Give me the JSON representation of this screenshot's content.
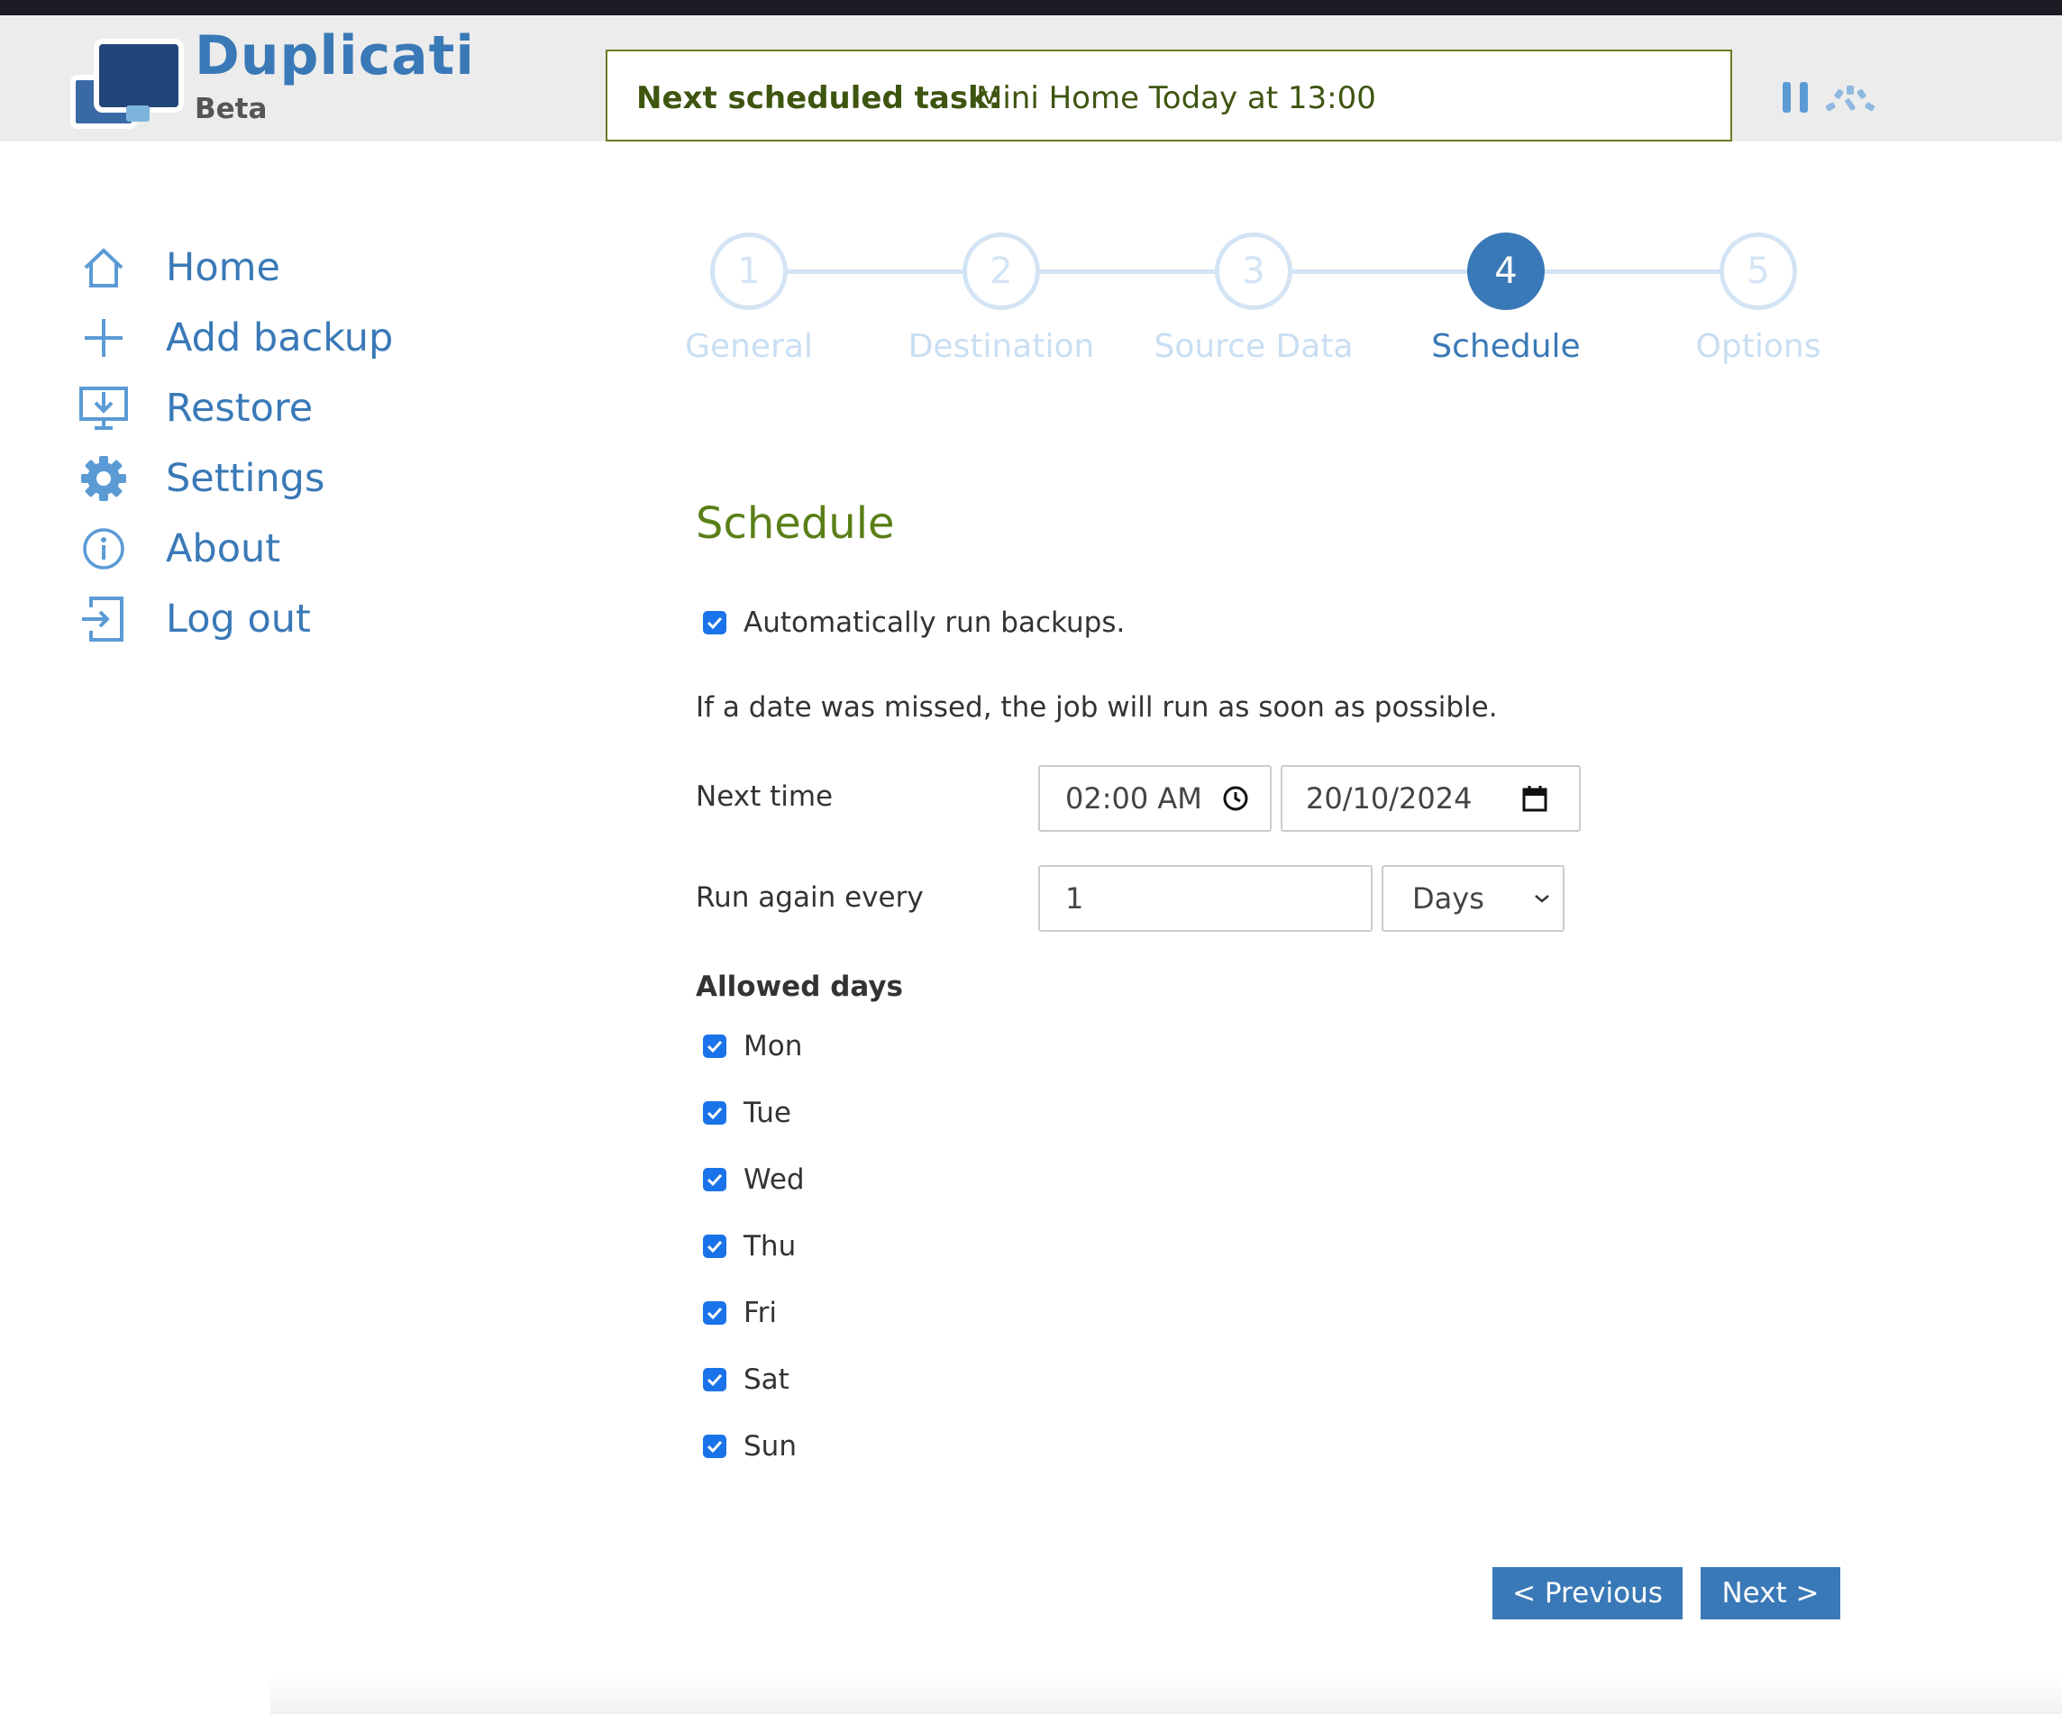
{
  "app": {
    "name": "Duplicati",
    "edition": "Beta"
  },
  "status": {
    "label": "Next scheduled task:",
    "value": "Mini Home Today at 13:00"
  },
  "toolbar_icons": [
    "pause-icon",
    "throttle-icon"
  ],
  "sidebar": {
    "items": [
      {
        "label": "Home",
        "icon": "home-icon"
      },
      {
        "label": "Add backup",
        "icon": "plus-icon"
      },
      {
        "label": "Restore",
        "icon": "restore-icon"
      },
      {
        "label": "Settings",
        "icon": "gear-icon"
      },
      {
        "label": "About",
        "icon": "info-icon"
      },
      {
        "label": "Log out",
        "icon": "logout-icon"
      }
    ]
  },
  "wizard": {
    "active_step": 4,
    "steps": [
      {
        "number": "1",
        "label": "General"
      },
      {
        "number": "2",
        "label": "Destination"
      },
      {
        "number": "3",
        "label": "Source Data"
      },
      {
        "number": "4",
        "label": "Schedule"
      },
      {
        "number": "5",
        "label": "Options"
      }
    ]
  },
  "schedule": {
    "title": "Schedule",
    "auto_run_label": "Automatically run backups.",
    "auto_run_checked": true,
    "missed_note": "If a date was missed, the job will run as soon as possible.",
    "next_time_label": "Next time",
    "next_time_value": "02:00 AM",
    "next_date_value": "20/10/2024",
    "run_again_label": "Run again every",
    "run_again_value": "1",
    "run_again_unit": "Days",
    "allowed_days_label": "Allowed days",
    "days": [
      {
        "label": "Mon",
        "checked": true
      },
      {
        "label": "Tue",
        "checked": true
      },
      {
        "label": "Wed",
        "checked": true
      },
      {
        "label": "Thu",
        "checked": true
      },
      {
        "label": "Fri",
        "checked": true
      },
      {
        "label": "Sat",
        "checked": true
      },
      {
        "label": "Sun",
        "checked": true
      }
    ]
  },
  "nav_buttons": {
    "previous": "< Previous",
    "next": "Next >"
  },
  "colors": {
    "accent": "#3a79b7",
    "status_text": "#3e5510",
    "section_title": "#5a7f17",
    "checkbox": "#1a73e8"
  }
}
